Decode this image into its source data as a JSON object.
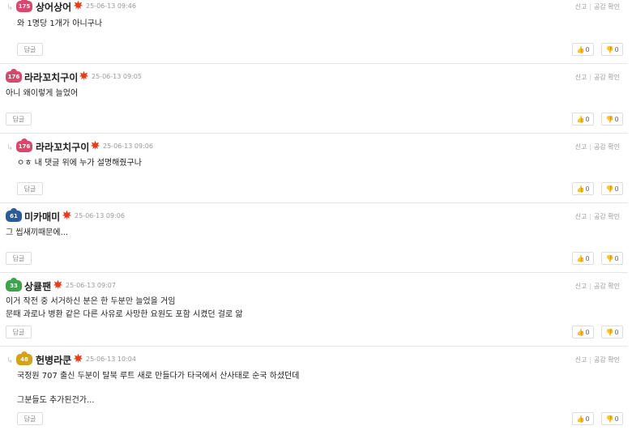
{
  "actions": {
    "report": "신고",
    "separator": "|",
    "view_likes": "공감 확인"
  },
  "reply_button_label": "답글",
  "comments": [
    {
      "level": "175",
      "nickname": "상어상어",
      "date": "25-06-13 09:46",
      "lines": [
        "와 1명당 1개가 아니구나"
      ],
      "up": "0",
      "down": "0",
      "badge_color": "#d9476c"
    },
    {
      "level": "176",
      "nickname": "라라꼬치구이",
      "date": "25-06-13 09:05",
      "lines": [
        "아니 왜이렇게 늘었어"
      ],
      "up": "0",
      "down": "0",
      "badge_color": "#d9476c"
    },
    {
      "level": "176",
      "nickname": "라라꼬치구이",
      "date": "25-06-13 09:06",
      "lines": [
        "ㅇㅎ 내 댓글 위에 누가 설명해줬구나"
      ],
      "up": "0",
      "down": "0",
      "badge_color": "#d9476c"
    },
    {
      "level": "61",
      "nickname": "미카매미",
      "date": "25-06-13 09:06",
      "lines": [
        "그 씹새끼때문에..."
      ],
      "up": "0",
      "down": "0",
      "badge_color": "#2a5b9a"
    },
    {
      "level": "33",
      "nickname": "상큘팬",
      "date": "25-06-13 09:07",
      "lines": [
        "이거 작전 중 서거하신 분은 한 두분만 늘었을 거임",
        "문때 과로나 병환 같은 다른 사유로 사망한 요원도 포함 시켰던 걸로 앎"
      ],
      "up": "0",
      "down": "0",
      "badge_color": "#3fa34d"
    },
    {
      "level": "48",
      "nickname": "헌병라쿤",
      "date": "25-06-13 10:04",
      "lines": [
        "국정원 707 출신 두분이 탈북 루트 새로 만들다가 타국에서 산사태로 순국 하셨던데",
        "",
        "그분들도 추가된건가..."
      ],
      "up": "0",
      "down": "0",
      "badge_color": "#d6a21a"
    }
  ]
}
